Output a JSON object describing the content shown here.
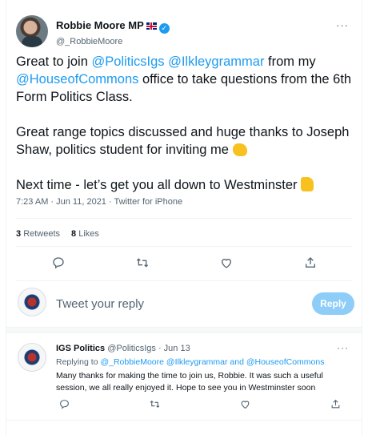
{
  "tweet": {
    "author_name": "Robbie Moore MP",
    "author_handle": "@_RobbieMoore",
    "more_label": "···",
    "body": {
      "p1_before": "Great to join ",
      "mention_politics": "@PoliticsIgs",
      "mention_ilkley": "@Ilkleygrammar",
      "p1_mid": " from my ",
      "mention_commons": "@HouseofCommons",
      "p1_after": " office to take questions from the 6th Form Politics Class.",
      "p2": "Great range topics discussed and huge thanks to Joseph Shaw, politics student for inviting me ",
      "p3": "Next time - let’s get you all down to Westminster "
    },
    "timestamp": "7:23 AM · Jun 11, 2021 · Twitter for iPhone",
    "retweets_count": "3",
    "retweets_label": "Retweets",
    "likes_count": "8",
    "likes_label": "Likes",
    "icons": [
      "reply-icon",
      "retweet-icon",
      "like-icon",
      "share-icon"
    ]
  },
  "reply_composer": {
    "placeholder": "Tweet your reply",
    "button_label": "Reply"
  },
  "reply_tweet": {
    "author_name": "IGS Politics",
    "author_handle": "@PoliticsIgs",
    "date": "Jun 13",
    "more_label": "···",
    "replying_to_label": "Replying to ",
    "replying_to_mentions": "@_RobbieMoore @Ilkleygrammar and @HouseofCommons",
    "text": "Many thanks for making the time to join us, Robbie. It was such a useful session, we all really enjoyed it. Hope to see you in Westminster soon"
  },
  "colors": {
    "accent": "#1d9bf0",
    "reply_button_disabled": "#8ecdf8",
    "secondary_text": "#536471"
  }
}
